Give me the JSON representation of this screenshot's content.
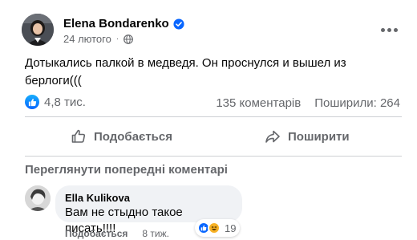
{
  "post": {
    "author": "Elena Bondarenko",
    "date": "24 лютого",
    "text": "Дотыкались палкой в медведя. Он проснулся и вышел из берлоги(((",
    "reactions_count": "4,8 тис.",
    "comments_count": "135 коментарів",
    "shares_count": "Поширили: 264"
  },
  "actions": {
    "like_label": "Подобається",
    "share_label": "Поширити"
  },
  "comments": {
    "view_previous": "Переглянути попередні коментарі",
    "items": [
      {
        "author": "Ella Kulikova",
        "text": "Вам не стыдно такое писать!!!!",
        "reaction_count": "19",
        "like_label": "Подобається",
        "time": "8 тиж."
      }
    ]
  },
  "colors": {
    "accent": "#0866ff",
    "secondary_text": "#65676b",
    "bubble": "#f0f2f5"
  },
  "icons": [
    "verified-badge-icon",
    "globe-icon",
    "more-icon",
    "like-icon",
    "thumbs-up-icon",
    "share-icon",
    "haha-icon"
  ]
}
